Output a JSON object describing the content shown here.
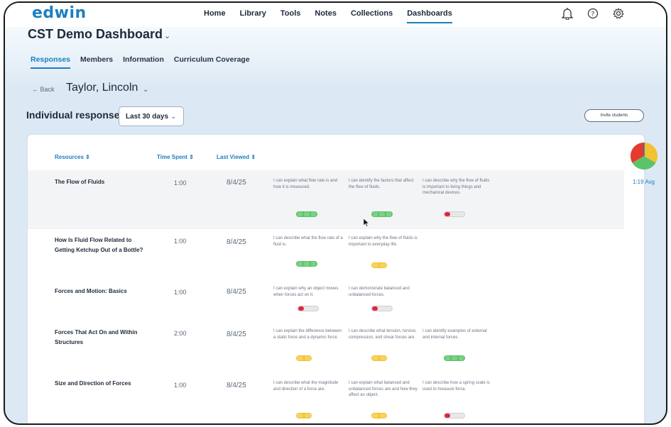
{
  "app": {
    "logo": "edwin",
    "nav": [
      "Home",
      "Library",
      "Tools",
      "Notes",
      "Collections",
      "Dashboards"
    ],
    "nav_active": "Dashboards",
    "icons": [
      "notification-icon",
      "help-icon",
      "settings-icon"
    ]
  },
  "dashboard": {
    "title": "CST Demo Dashboard",
    "tabs": [
      "Responses",
      "Members",
      "Information",
      "Curriculum Coverage"
    ],
    "active_tab": "Responses",
    "back_label": "← Back",
    "student": "Taylor, Lincoln",
    "section_title": "Individual responses",
    "period": "Last 30 days",
    "invite_label": "Invite students"
  },
  "table": {
    "headers": [
      "Resources",
      "Time Spent",
      "Last Viewed"
    ],
    "rows": [
      {
        "title": "The Flow of Fluids",
        "time": "1:00",
        "viewed": "8/4/25",
        "statements": [
          {
            "text": "I can explain what flow rate is and how it is measured.",
            "level": "green"
          },
          {
            "text": "I can identify the factors that affect the flow of fluids.",
            "level": "green"
          },
          {
            "text": "I can describe why the flow of fluids is important to living things and mechanical devices.",
            "level": "red"
          }
        ]
      },
      {
        "title": "How Is Fluid Flow Related to Getting Ketchup Out of a Bottle?",
        "time": "1:00",
        "viewed": "8/4/25",
        "statements": [
          {
            "text": "I can describe what the flow rate of a fluid is.",
            "level": "green"
          },
          {
            "text": "I can explain why the flow of fluids is important to everyday life.",
            "level": "yellow"
          }
        ]
      },
      {
        "title": "Forces and Motion: Basics",
        "time": "1:00",
        "viewed": "8/4/25",
        "statements": [
          {
            "text": "I can explain why an object moves when forces act on it.",
            "level": "red"
          },
          {
            "text": "I can demonstrate balanced and unbalanced forces.",
            "level": "red"
          }
        ]
      },
      {
        "title": "Forces That Act On and Within Structures",
        "time": "2:00",
        "viewed": "8/4/25",
        "statements": [
          {
            "text": "I can explain the difference between a static force and a dynamic force.",
            "level": "yellow"
          },
          {
            "text": "I can describe what tension, torsion, compression, and shear forces are.",
            "level": "yellow"
          },
          {
            "text": "I can identify examples of external and internal forces.",
            "level": "green"
          }
        ]
      },
      {
        "title": "Size and Direction of Forces",
        "time": "1:00",
        "viewed": "8/4/25",
        "statements": [
          {
            "text": "I can describe what the magnitude and direction of a force are.",
            "level": "yellow"
          },
          {
            "text": "I can explain what balanced and unbalanced forces are and how they affect an object.",
            "level": "yellow"
          },
          {
            "text": "I can describe how a spring scale is used to measure force.",
            "level": "red"
          }
        ]
      }
    ]
  },
  "side_widget": {
    "label": "1:19 Avg",
    "colors": [
      "#e63a2e",
      "#f2c230",
      "#5ec26b",
      "#2f6fb0"
    ]
  }
}
